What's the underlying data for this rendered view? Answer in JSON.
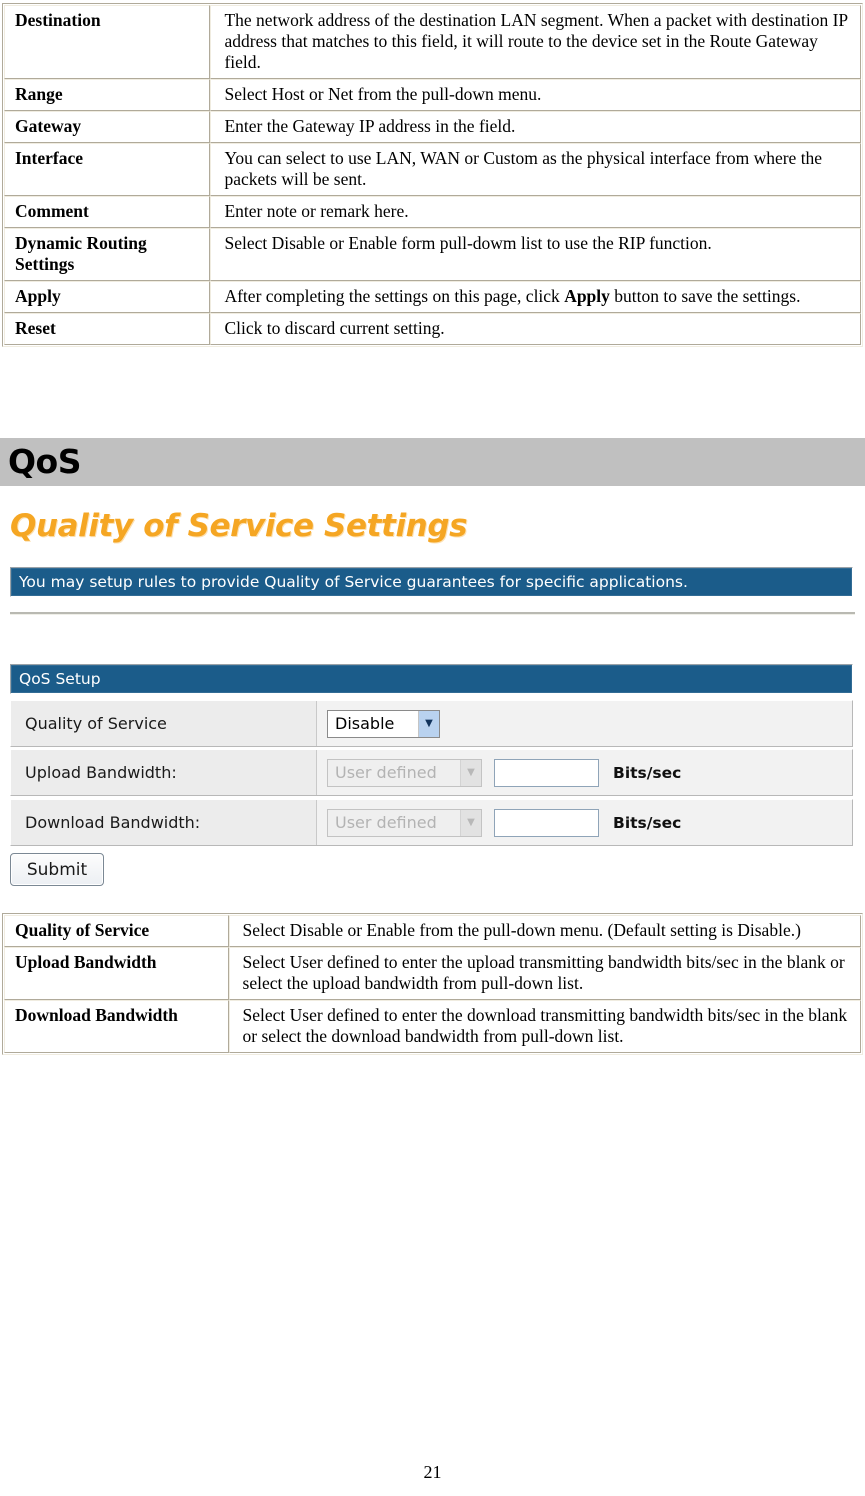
{
  "routing_table": {
    "rows": [
      {
        "key": "Destination",
        "value": "The network address of the destination LAN segment. When a packet with destination IP address that matches to this field, it will route to the device set in the Route Gateway field."
      },
      {
        "key": "Range",
        "value": "Select Host or Net from the pull-down menu."
      },
      {
        "key": "Gateway",
        "value": "Enter the Gateway IP address in the field."
      },
      {
        "key": "Interface",
        "value": "You can select to use LAN, WAN or Custom as the physical interface from where the packets will be sent."
      },
      {
        "key": "Comment",
        "value": "Enter note or remark here."
      },
      {
        "key": "Dynamic Routing Settings",
        "value": "Select Disable or Enable form pull-dowm list to use the RIP function."
      },
      {
        "key": "Apply",
        "value_pre": "After completing the settings on this page, click ",
        "value_bold": "Apply",
        "value_post": " button to save the settings."
      },
      {
        "key": "Reset",
        "value": "Click to discard current setting."
      }
    ]
  },
  "section": {
    "heading": "QoS"
  },
  "router_ui": {
    "title": "Quality of Service Settings",
    "info_bar": "You may setup rules to provide Quality of Service guarantees for specific applications.",
    "setup_bar": "QoS Setup",
    "rows": [
      {
        "label": "Quality of Service",
        "select_value": "Disable",
        "disabled": false,
        "has_textbox": false,
        "unit": ""
      },
      {
        "label": "Upload Bandwidth:",
        "select_value": "User defined",
        "disabled": true,
        "has_textbox": true,
        "textbox_value": "",
        "unit": "Bits/sec"
      },
      {
        "label": "Download Bandwidth:",
        "select_value": "User defined",
        "disabled": true,
        "has_textbox": true,
        "textbox_value": "",
        "unit": "Bits/sec"
      }
    ],
    "submit_label": "Submit",
    "colors": {
      "band": "#c0c0c0",
      "blue_bar": "#1b5c8a",
      "title_orange": "#f5a623",
      "row_bg": "#ececec"
    }
  },
  "qos_table": {
    "rows": [
      {
        "key": "Quality of Service",
        "value": "Select Disable or Enable from the pull-down menu. (Default setting is Disable.)"
      },
      {
        "key": "Upload Bandwidth",
        "value": "Select User defined to enter the upload transmitting bandwidth bits/sec in the blank or select the upload bandwidth from pull-down list."
      },
      {
        "key": "Download Bandwidth",
        "value": "Select User defined to enter the download transmitting bandwidth bits/sec in the blank or select the download bandwidth from pull-down list."
      }
    ]
  },
  "footer": {
    "page_number": "21"
  }
}
